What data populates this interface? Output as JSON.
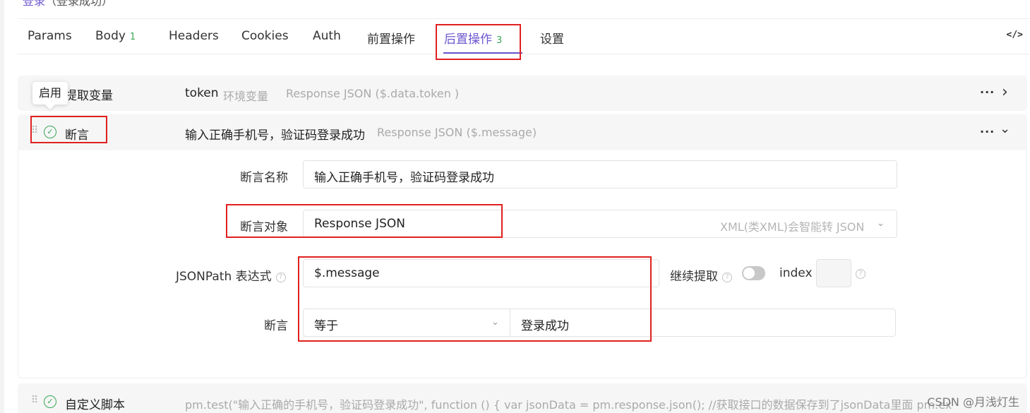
{
  "breadcrumb": {
    "link": "登录",
    "suffix": "（登录成功）"
  },
  "tabs": [
    {
      "label": "Params"
    },
    {
      "label": "Body",
      "count": "1"
    },
    {
      "label": "Headers"
    },
    {
      "label": "Cookies"
    },
    {
      "label": "Auth"
    },
    {
      "label": "前置操作"
    },
    {
      "label": "后置操作",
      "count": "3"
    },
    {
      "label": "设置"
    }
  ],
  "code_toggle": "</>",
  "tooltip": "启用",
  "rows": {
    "extract": {
      "title": "提取变量",
      "var": "token",
      "scope": "环境变量",
      "source": "Response JSON ($.data.token )"
    },
    "assert": {
      "title": "断言",
      "name": "输入正确手机号，验证码登录成功",
      "source": "Response JSON ($.message)"
    },
    "script": {
      "title": "自定义脚本",
      "code": "pm.test(\"输入正确的手机号，验证码登录成功\", function () { var jsonData = pm.response.json(); //获取接口的数据保存到了jsonData里面 pm.ex"
    }
  },
  "row_actions": {
    "more": "···",
    "expand": "›",
    "collapse": "⌄"
  },
  "form": {
    "name_label": "断言名称",
    "name_value": "输入正确手机号，验证码登录成功",
    "target_label": "断言对象",
    "target_value": "Response JSON",
    "target_hint": "XML(类XML)会智能转 JSON",
    "jsonpath_label": "JSONPath 表达式",
    "jsonpath_value": "$.message",
    "continue_label": "继续提取",
    "index_label": "index",
    "assert_label": "断言",
    "operator": "等于",
    "expected": "登录成功"
  },
  "watermark": "CSDN @月浅灯生",
  "colors": {
    "accent": "#6e56cf",
    "success": "#3aa757",
    "highlight": "#e02020"
  }
}
